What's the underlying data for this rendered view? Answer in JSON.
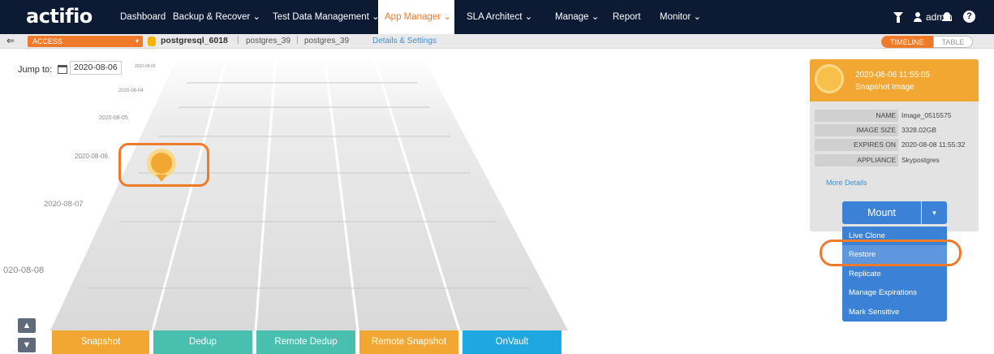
{
  "app": {
    "logo": "actifio"
  },
  "nav": {
    "items": [
      {
        "label": "Dashboard"
      },
      {
        "label": "Backup & Recover ⌄"
      },
      {
        "label": "Test Data Management ⌄"
      },
      {
        "label": "App Manager ⌄"
      },
      {
        "label": "SLA Architect ⌄"
      },
      {
        "label": "Manage ⌄"
      },
      {
        "label": "Report"
      },
      {
        "label": "Monitor ⌄"
      }
    ],
    "user": "admin",
    "help": "?"
  },
  "subbar": {
    "back": "⇐",
    "access": "ACCESS",
    "access_caret": "▾",
    "db_name": "postgresql_6018",
    "sep": "|",
    "host": "postgres_39",
    "app": "postgres_39",
    "details_link": "Details & Settings",
    "view_timeline": "TIMELINE",
    "view_table": "TABLE"
  },
  "jump": {
    "label": "Jump to:",
    "date": "2020-08-06"
  },
  "timeline": {
    "dates": [
      "2020-08-03",
      "2020-08-04",
      "2020-08-05",
      "2020-08-06",
      "2020-08-07",
      "020-08-08"
    ]
  },
  "scroll": {
    "up": "▲",
    "down": "▼"
  },
  "lanes": [
    {
      "label": "Snapshot",
      "color": "#f2a733"
    },
    {
      "label": "Dedup",
      "color": "#49bfb0"
    },
    {
      "label": "Remote Dedup",
      "color": "#49bfb0"
    },
    {
      "label": "Remote Snapshot",
      "color": "#f2a733"
    },
    {
      "label": "OnVault",
      "color": "#1ea7e1"
    }
  ],
  "image_info": {
    "datetime": "2020-08-06  11:55:05",
    "type": "Snapshot Image",
    "fields": [
      {
        "key": "NAME",
        "value": "Image_0515575"
      },
      {
        "key": "IMAGE SIZE",
        "value": "3328.02GB"
      },
      {
        "key": "EXPIRES ON",
        "value": "2020-08-08 11:55:32"
      },
      {
        "key": "APPLIANCE",
        "value": "Skypostgres"
      }
    ],
    "more_details": "More Details"
  },
  "mount": {
    "label": "Mount",
    "caret": "▾",
    "menu": [
      {
        "label": "Live Clone"
      },
      {
        "label": "Restore"
      },
      {
        "label": "Replicate"
      },
      {
        "label": "Manage Expirations"
      },
      {
        "label": "Mark Sensitive"
      }
    ]
  },
  "colors": {
    "nav_bg": "#0c1a33",
    "accent": "#ef7a2a",
    "blue": "#3b82d6",
    "snapshot": "#f2a733"
  }
}
